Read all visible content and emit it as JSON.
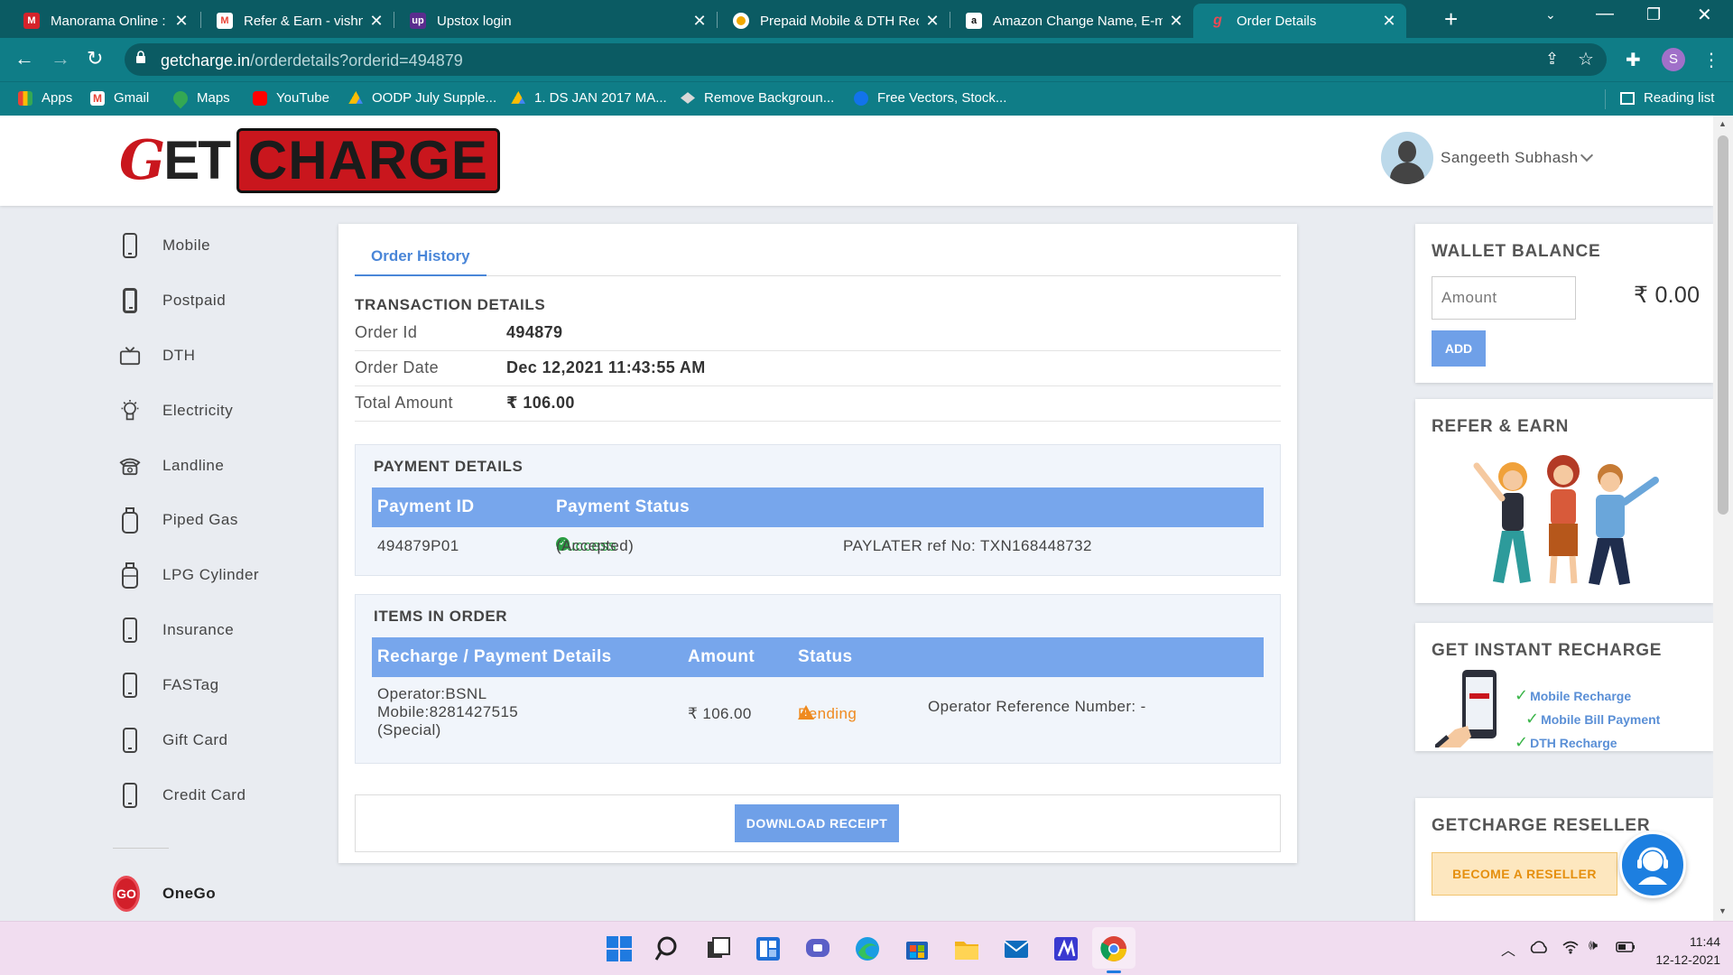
{
  "browser": {
    "tabs": [
      {
        "title": "Manorama Online : Breakin",
        "icon": "manorama-icon",
        "color": "#d5232b"
      },
      {
        "title": "Refer & Earn - vishnusange",
        "icon": "gmail-icon",
        "color": "#ea4335"
      },
      {
        "title": "Upstox login",
        "icon": "upstox-icon",
        "color": "#5a2d8e"
      },
      {
        "title": "Prepaid Mobile & DTH Rech",
        "icon": "prepaid-icon",
        "color": "#f2a900"
      },
      {
        "title": "Amazon Change Name, E-m",
        "icon": "amazon-icon",
        "color": "#ffffff"
      },
      {
        "title": "Order Details",
        "icon": "getcharge-icon",
        "color": "#c9161d"
      }
    ],
    "new_tab": "+",
    "url_host": "getcharge.in",
    "url_path": "/orderdetails?orderid=494879",
    "profile_initial": "S",
    "bookmarks": [
      {
        "label": "Apps",
        "icon": "apps-grid-icon"
      },
      {
        "label": "Gmail",
        "icon": "gmail-icon"
      },
      {
        "label": "Maps",
        "icon": "maps-icon"
      },
      {
        "label": "YouTube",
        "icon": "youtube-icon"
      },
      {
        "label": "OODP July Supple...",
        "icon": "drive-icon"
      },
      {
        "label": "1. DS JAN 2017 MA...",
        "icon": "drive-icon"
      },
      {
        "label": "Remove Backgroun...",
        "icon": "removebg-icon"
      },
      {
        "label": "Free Vectors, Stock...",
        "icon": "freepik-icon"
      }
    ],
    "reading_list": "Reading list"
  },
  "header": {
    "logo_get": "G",
    "logo_et": "ET",
    "logo_charge": "CHARGE",
    "user_name": "Sangeeth Subhash"
  },
  "sidebar": {
    "items": [
      {
        "label": "Mobile"
      },
      {
        "label": "Postpaid"
      },
      {
        "label": "DTH"
      },
      {
        "label": "Electricity"
      },
      {
        "label": "Landline"
      },
      {
        "label": "Piped Gas"
      },
      {
        "label": "LPG Cylinder"
      },
      {
        "label": "Insurance"
      },
      {
        "label": "FASTag"
      },
      {
        "label": "Gift Card"
      },
      {
        "label": "Credit Card"
      }
    ],
    "onego_badge": "GO",
    "onego_label": "OneGo"
  },
  "main": {
    "tab_label": "Order History",
    "transaction_title": "TRANSACTION DETAILS",
    "order_id_label": "Order Id",
    "order_id": "494879",
    "order_date_label": "Order Date",
    "order_date": "Dec 12,2021 11:43:55 AM",
    "total_label": "Total Amount",
    "total": "₹ 106.00",
    "payment": {
      "title": "PAYMENT DETAILS",
      "col_id": "Payment ID",
      "col_status": "Payment Status",
      "payment_id": "494879P01",
      "status": "Success",
      "status_note": "(Accepted)",
      "ref": "PAYLATER ref No: TXN168448732"
    },
    "items": {
      "title": "ITEMS IN ORDER",
      "col_details": "Recharge / Payment Details",
      "col_amount": "Amount",
      "col_status": "Status",
      "operator": "Operator:BSNL",
      "mobile": "Mobile:8281427515",
      "plan": "(Special)",
      "amount": "₹ 106.00",
      "status": "Pending",
      "operator_ref": "Operator Reference Number: -"
    },
    "download_label": "DOWNLOAD RECEIPT"
  },
  "right": {
    "wallet_title": "WALLET BALANCE",
    "amount_placeholder": "Amount",
    "balance": "₹ 0.00",
    "add_label": "ADD",
    "refer_title": "REFER & EARN",
    "instant_title": "GET INSTANT RECHARGE",
    "instant_items": [
      "Mobile Recharge",
      "Mobile Bill Payment",
      "DTH Recharge"
    ],
    "reseller_title": "GETCHARGE RESELLER",
    "reseller_button": "BECOME A RESELLER"
  },
  "taskbar": {
    "time": "11:44",
    "date": "12-12-2021"
  },
  "colors": {
    "brand_red": "#c9161d",
    "accent_blue": "#77a6ec",
    "success": "#2a9d42",
    "pending": "#ef8a1f",
    "chrome_teal": "#0f7d87"
  }
}
